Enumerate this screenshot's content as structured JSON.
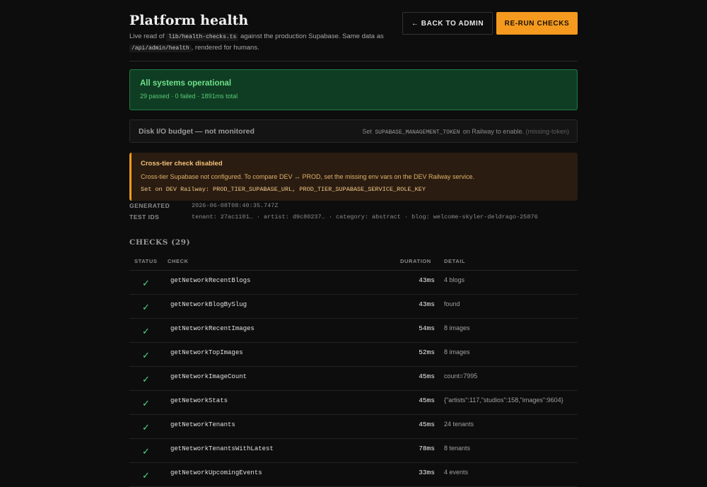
{
  "header": {
    "title": "Platform health",
    "subtitle_pre": "Live read of",
    "subtitle_code1": "lib/health-checks.ts",
    "subtitle_mid": "against the production Supabase. Same data as",
    "subtitle_code2": "/api/admin/health",
    "subtitle_post": ", rendered for humans.",
    "back_label": "← BACK TO ADMIN",
    "rerun_label": "RE-RUN CHECKS"
  },
  "status": {
    "title": "All systems operational",
    "summary": "29 passed · 0 failed · 1891ms total"
  },
  "disk": {
    "title": "Disk I/O budget — not monitored",
    "hint_pre": "Set",
    "hint_code": "SUPABASE_MANAGEMENT_TOKEN",
    "hint_post": "on Railway to enable.",
    "reason": "(missing-token)"
  },
  "warning": {
    "title": "Cross-tier check disabled",
    "body": "Cross-tier Supabase not configured. To compare DEV ↔ PROD, set the missing env vars on the DEV Railway service.",
    "code": "Set on DEV Railway: PROD_TIER_SUPABASE_URL, PROD_TIER_SUPABASE_SERVICE_ROLE_KEY"
  },
  "meta": {
    "generated_label": "GENERATED",
    "generated_value": "2026-06-08T08:40:35.747Z",
    "test_ids_label": "TEST IDS",
    "test_ids_value": "tenant: 27ac1101…  · artist: d9c80237…  · category: abstract  · blog: welcome-skyler-deldrago-25876"
  },
  "checks": {
    "heading": "CHECKS (29)",
    "columns": {
      "status": "STATUS",
      "check": "CHECK",
      "duration": "DURATION",
      "detail": "DETAIL"
    },
    "rows": [
      {
        "status": "✓",
        "name": "getNetworkRecentBlogs",
        "duration": "43ms",
        "detail": "4 blogs"
      },
      {
        "status": "✓",
        "name": "getNetworkBlogBySlug",
        "duration": "43ms",
        "detail": "found"
      },
      {
        "status": "✓",
        "name": "getNetworkRecentImages",
        "duration": "54ms",
        "detail": "8 images"
      },
      {
        "status": "✓",
        "name": "getNetworkTopImages",
        "duration": "52ms",
        "detail": "8 images"
      },
      {
        "status": "✓",
        "name": "getNetworkImageCount",
        "duration": "45ms",
        "detail": "count=7995"
      },
      {
        "status": "✓",
        "name": "getNetworkStats",
        "duration": "45ms",
        "detail": "{\"artists\":117,\"studios\":158,\"images\":9604}"
      },
      {
        "status": "✓",
        "name": "getNetworkTenants",
        "duration": "45ms",
        "detail": "24 tenants"
      },
      {
        "status": "✓",
        "name": "getNetworkTenantsWithLatest",
        "duration": "78ms",
        "detail": "8 tenants"
      },
      {
        "status": "✓",
        "name": "getNetworkUpcomingEvents",
        "duration": "33ms",
        "detail": "4 events"
      }
    ]
  },
  "colors": {
    "accent": "#f59a1f",
    "success": "#4ade80",
    "background": "#0d0d0d"
  },
  "icons": {
    "pass": "check-icon"
  }
}
